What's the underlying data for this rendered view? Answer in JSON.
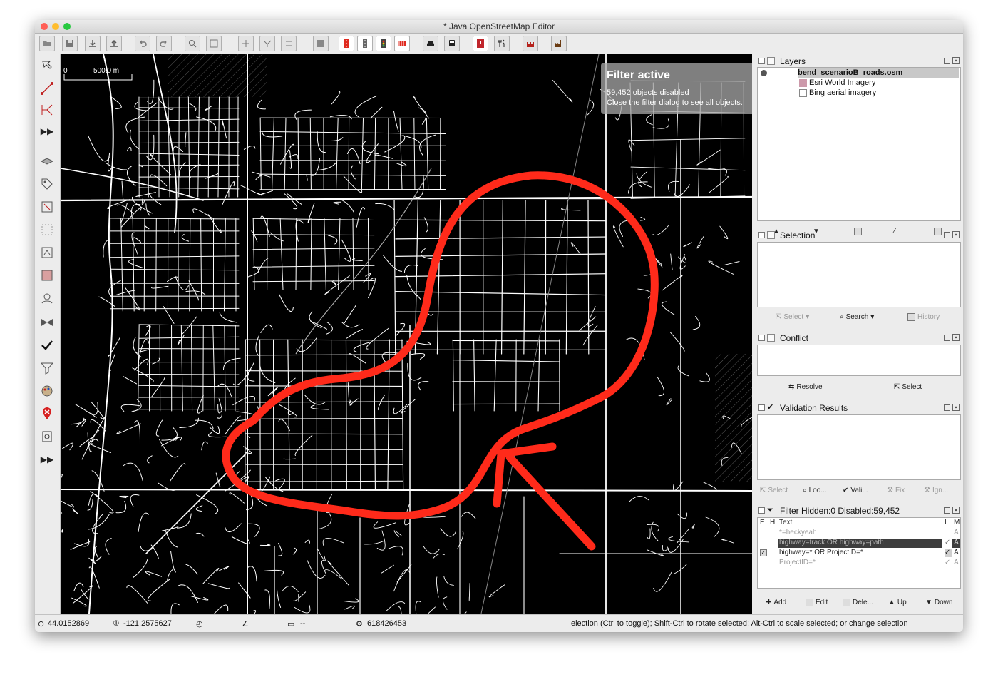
{
  "window": {
    "title": "* Java OpenStreetMap Editor"
  },
  "osd": {
    "heading": "Filter active",
    "line1": "59,452 objects disabled",
    "line2": "Close the filter dialog to see all objects."
  },
  "scale": {
    "label": "500.0 m",
    "zero": "0"
  },
  "layers": {
    "title": "Layers",
    "items": [
      "bend_scenarioB_roads.osm",
      "Esri World Imagery",
      "Bing aerial imagery"
    ]
  },
  "selection": {
    "title": "Selection",
    "select_label": "Select",
    "search_label": "Search",
    "history_label": "History"
  },
  "conflict": {
    "title": "Conflict",
    "resolve_label": "Resolve",
    "select_label": "Select"
  },
  "validation": {
    "title": "Validation Results",
    "buttons": [
      "Select",
      "Loo...",
      "Vali...",
      "Fix",
      "Ign..."
    ]
  },
  "filter": {
    "title": "Filter Hidden:0 Disabled:59,452",
    "col_e": "E",
    "col_h": "H",
    "col_text": "Text",
    "col_i": "I",
    "col_m": "M",
    "rows": [
      {
        "text": "*=heckyeah",
        "mode": "A",
        "inv": ""
      },
      {
        "text": "highway=track OR highway=path",
        "mode": "A",
        "inv": "✓"
      },
      {
        "text": "highway=* OR ProjectID=*",
        "mode": "A",
        "inv": "✓"
      },
      {
        "text": "ProjectID=*",
        "mode": "A",
        "inv": "✓"
      }
    ],
    "buttons": [
      "Add",
      "Edit",
      "Dele...",
      "Up",
      "Down"
    ]
  },
  "status": {
    "lat": "44.0152869",
    "lon": "-121.2575627",
    "dist": "--",
    "id": "618426453",
    "help": "election (Ctrl to toggle); Shift-Ctrl to rotate selected; Alt-Ctrl to scale selected; or change selection"
  },
  "colors": {
    "map_bg": "#000000",
    "road": "#ffffff",
    "annotation": "#ff2a1a",
    "traffic_close": "#ff5f57",
    "traffic_min": "#ffbd2e",
    "traffic_max": "#28c940"
  }
}
